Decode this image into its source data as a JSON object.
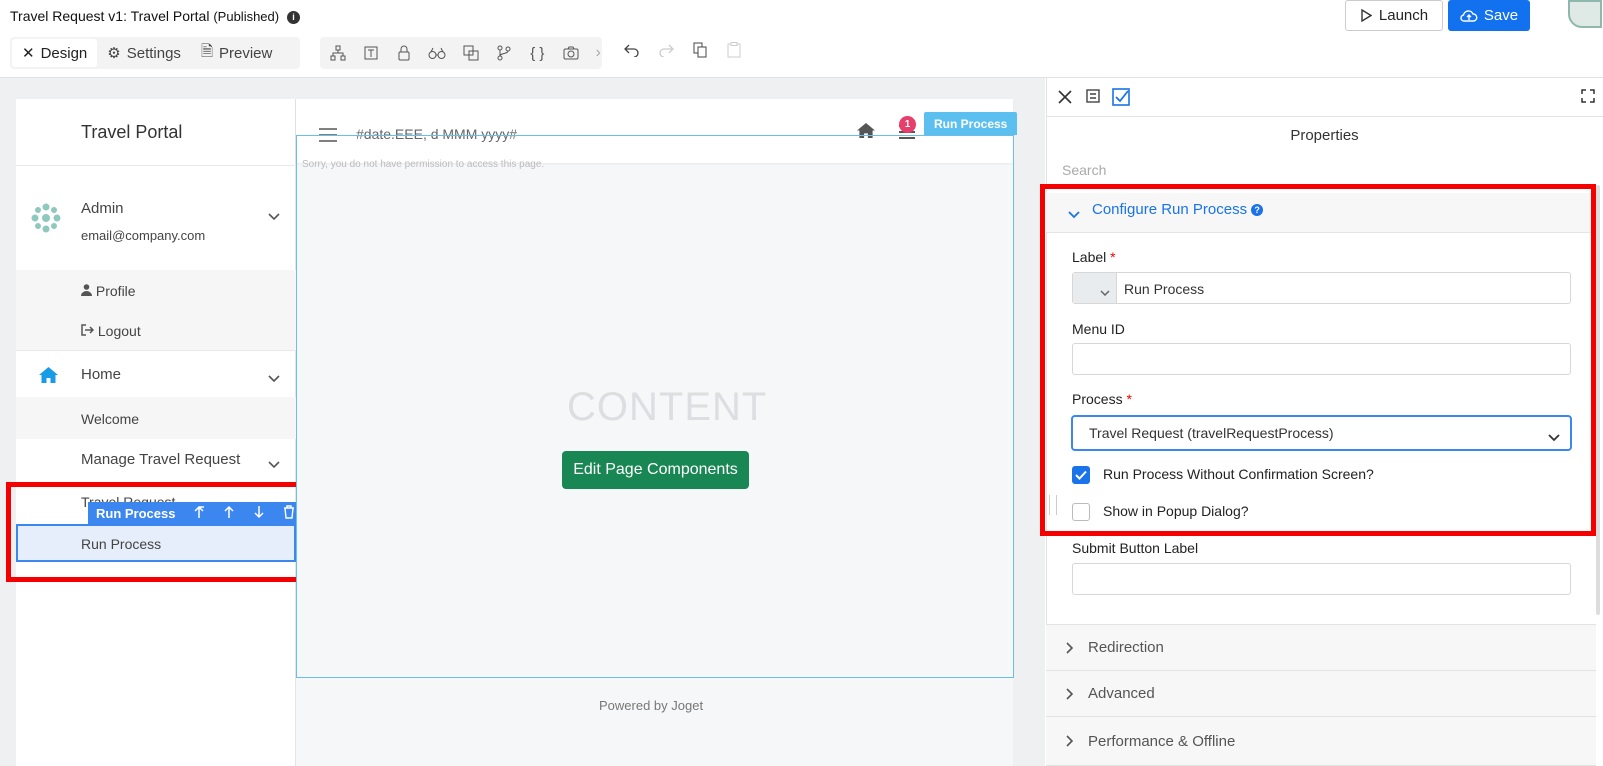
{
  "header": {
    "title": "Travel Request v1: Travel Portal",
    "status": "(Published)",
    "info_icon": "info-icon",
    "launch_label": "Launch",
    "save_label": "Save"
  },
  "mode_tabs": [
    {
      "label": "Design",
      "icon": "design-icon"
    },
    {
      "label": "Settings",
      "icon": "gear-icon"
    },
    {
      "label": "Preview",
      "icon": "preview-icon"
    }
  ],
  "toolbar_icons": [
    "tree-icon",
    "text-icon",
    "lock-icon",
    "binoculars-icon",
    "translate-icon",
    "branch-icon",
    "braces-icon",
    "camera-icon",
    "chevron-right-icon"
  ],
  "history_icons": [
    "undo-icon",
    "redo-icon",
    "copy-icon",
    "paste-icon"
  ],
  "sidebar": {
    "brand": "Travel Portal",
    "user_name": "Admin",
    "user_email": "email@company.com",
    "profile": "Profile",
    "logout": "Logout",
    "home": "Home",
    "welcome": "Welcome",
    "manage": "Manage Travel Request",
    "travel_partial": "Travel Request",
    "run_process": "Run Process"
  },
  "floating_toolbar": {
    "label": "Run Process"
  },
  "canvas": {
    "date_template": "#date.EEE, d MMM yyyy#",
    "permission_msg": "Sorry, you do not have permission to access this page.",
    "content": "CONTENT",
    "edit_button": "Edit Page Components",
    "powered_by": "Powered by Joget",
    "badge": "Run Process",
    "notif_count": "1"
  },
  "properties": {
    "title": "Properties",
    "search_placeholder": "Search",
    "section_title": "Configure Run Process",
    "label_field": "Label",
    "label_value": "Run Process",
    "menu_id_field": "Menu ID",
    "menu_id_value": "",
    "process_field": "Process",
    "process_value": "Travel Request (travelRequestProcess)",
    "cb1_label": "Run Process Without Confirmation Screen?",
    "cb1_checked": true,
    "cb2_label": "Show in Popup Dialog?",
    "cb2_checked": false,
    "submit_label_field": "Submit Button Label",
    "submit_label_value": "",
    "sections": [
      "Redirection",
      "Advanced",
      "Performance & Offline"
    ]
  },
  "colors": {
    "accent": "#1a73e8",
    "save": "#1271ee",
    "edit_button": "#198754",
    "highlight": "#f40000"
  }
}
